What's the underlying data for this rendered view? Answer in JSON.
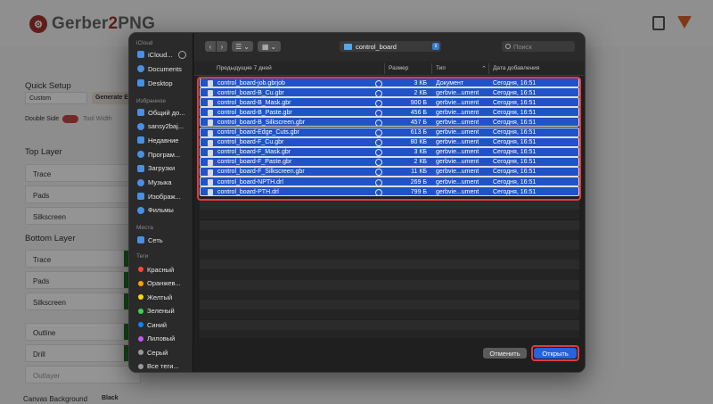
{
  "app": {
    "logo_prefix": "Gerber",
    "logo_mid": "2",
    "logo_suffix": "PNG",
    "quick_setup": "Quick Setup",
    "preset": "Custom",
    "generate": "Generate E",
    "double_side": "Double Side",
    "tool_width": "Tool Width",
    "top_layer": "Top Layer",
    "bottom_layer": "Bottom Layer",
    "top_fields": [
      "Trace",
      "Pads",
      "Silkscreen"
    ],
    "bottom_fields": [
      "Trace",
      "Pads",
      "Silkscreen"
    ],
    "extra_fields": [
      "Outline",
      "Drill",
      "Outlayer"
    ],
    "canvas_background": "Canvas Background",
    "canvas_value": "Black"
  },
  "dialog": {
    "sidebar": {
      "icloud_head": "iCloud",
      "icloud_items": [
        {
          "label": "iCloud...",
          "icon": "cloud-icon"
        },
        {
          "label": "Documents",
          "icon": "doc-icon"
        },
        {
          "label": "Desktop",
          "icon": "desktop-icon"
        }
      ],
      "favorites_head": "Избранное",
      "favorite_items": [
        {
          "label": "Общий до...",
          "icon": "shared-folder-icon"
        },
        {
          "label": "sansy2baj...",
          "icon": "home-icon"
        },
        {
          "label": "Недавние",
          "icon": "clock-icon"
        },
        {
          "label": "Програм...",
          "icon": "apps-icon"
        },
        {
          "label": "Загрузки",
          "icon": "download-icon"
        },
        {
          "label": "Музыка",
          "icon": "music-icon"
        },
        {
          "label": "Изображ...",
          "icon": "image-icon"
        },
        {
          "label": "Фильмы",
          "icon": "film-icon"
        }
      ],
      "places_head": "Места",
      "place_items": [
        {
          "label": "Сеть",
          "icon": "network-icon"
        }
      ],
      "tags_head": "Теги",
      "tags": [
        {
          "label": "Красный",
          "color": "#ff453a"
        },
        {
          "label": "Оранжев...",
          "color": "#ff9f0a"
        },
        {
          "label": "Желтый",
          "color": "#ffd60a"
        },
        {
          "label": "Зеленый",
          "color": "#32d74b"
        },
        {
          "label": "Синий",
          "color": "#0a84ff"
        },
        {
          "label": "Лиловый",
          "color": "#bf5af2"
        },
        {
          "label": "Серый",
          "color": "#98989d"
        },
        {
          "label": "Все теги...",
          "color": "#98989d"
        }
      ]
    },
    "toolbar": {
      "back": "‹",
      "forward": "›",
      "view_mode": "☰",
      "group_mode": "▦",
      "folder": "control_board",
      "search_placeholder": "Поиск"
    },
    "columns": {
      "name": "Предыдущие 7 дней",
      "size": "Размер",
      "type": "Тип",
      "date": "Дата добавления"
    },
    "files": [
      {
        "name": "control_board-job.gbrjob",
        "size": "3 КБ",
        "type": "Документ",
        "date": "Сегодня, 16:51"
      },
      {
        "name": "control_board-B_Cu.gbr",
        "size": "2 КБ",
        "type": "gerbvie...ument",
        "date": "Сегодня, 16:51"
      },
      {
        "name": "control_board-B_Mask.gbr",
        "size": "900 Б",
        "type": "gerbvie...ument",
        "date": "Сегодня, 16:51"
      },
      {
        "name": "control_board-B_Paste.gbr",
        "size": "456 Б",
        "type": "gerbvie...ument",
        "date": "Сегодня, 16:51"
      },
      {
        "name": "control_board-B_Silkscreen.gbr",
        "size": "457 Б",
        "type": "gerbvie...ument",
        "date": "Сегодня, 16:51"
      },
      {
        "name": "control_board-Edge_Cuts.gbr",
        "size": "613 Б",
        "type": "gerbvie...ument",
        "date": "Сегодня, 16:51"
      },
      {
        "name": "control_board-F_Cu.gbr",
        "size": "80 КБ",
        "type": "gerbvie...ument",
        "date": "Сегодня, 16:51"
      },
      {
        "name": "control_board-F_Mask.gbr",
        "size": "3 КБ",
        "type": "gerbvie...ument",
        "date": "Сегодня, 16:51"
      },
      {
        "name": "control_board-F_Paste.gbr",
        "size": "2 КБ",
        "type": "gerbvie...ument",
        "date": "Сегодня, 16:51"
      },
      {
        "name": "control_board-F_Silkscreen.gbr",
        "size": "11 КБ",
        "type": "gerbvie...ument",
        "date": "Сегодня, 16:51"
      },
      {
        "name": "control_board-NPTH.drl",
        "size": "269 Б",
        "type": "gerbvie...ument",
        "date": "Сегодня, 16:51"
      },
      {
        "name": "control_board-PTH.drl",
        "size": "799 Б",
        "type": "gerbvie...ument",
        "date": "Сегодня, 16:51"
      }
    ],
    "cancel": "Отменить",
    "open": "Открыть"
  },
  "colors": {
    "selection": "#1f53c7",
    "highlight_outline": "#e23a3a",
    "open_button": "#2464e0"
  }
}
